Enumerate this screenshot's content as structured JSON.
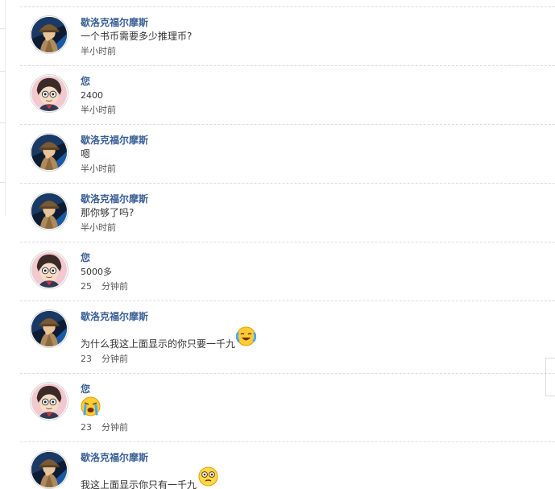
{
  "chat": {
    "messages": [
      {
        "sender": "歇洛克福尔摩斯",
        "avatar": "detective-avatar",
        "text": "一个书币需要多少推理币?",
        "time": "半小时前"
      },
      {
        "sender": "您",
        "avatar": "conan-avatar",
        "text": "2400",
        "time": "半小时前"
      },
      {
        "sender": "歇洛克福尔摩斯",
        "avatar": "detective-avatar",
        "text": "嗯",
        "time": "半小时前"
      },
      {
        "sender": "歇洛克福尔摩斯",
        "avatar": "detective-avatar",
        "text": "那你够了吗?",
        "time": "半小时前"
      },
      {
        "sender": "您",
        "avatar": "conan-avatar",
        "text": "5000多",
        "time_num": "25",
        "time_unit": "分钟前"
      },
      {
        "sender": "歇洛克福尔摩斯",
        "avatar": "detective-avatar",
        "text": "为什么我这上面显示的你只要一千九",
        "emoji": "laughing-tears-emoji",
        "time_num": "23",
        "time_unit": "分钟前"
      },
      {
        "sender": "您",
        "avatar": "conan-avatar",
        "text": "",
        "emoji": "crying-emoji",
        "time_num": "23",
        "time_unit": "分钟前"
      },
      {
        "sender": "歇洛克福尔摩斯",
        "avatar": "detective-avatar",
        "text": "我这上面显示你只有一千九",
        "emoji": "shocked-face-emoji"
      }
    ]
  },
  "colors": {
    "sender_name": "#3a5f96",
    "message_text": "#333333",
    "divider": "#dcdcdc"
  }
}
